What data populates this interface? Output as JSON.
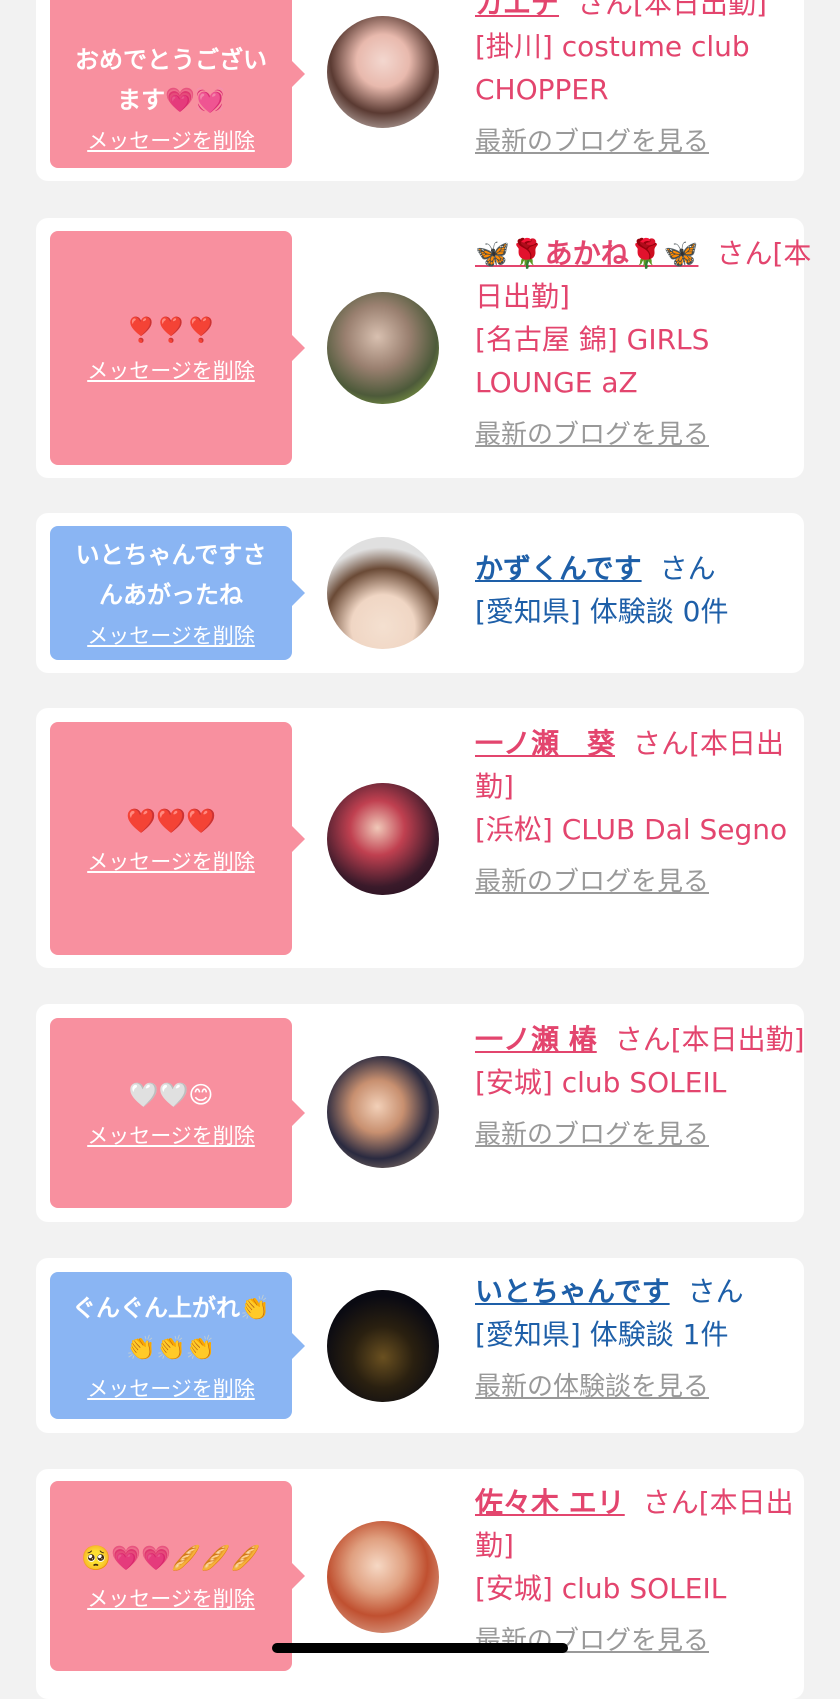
{
  "colors": {
    "pink_bubble": "#f8909f",
    "blue_bubble": "#8ab5f3",
    "pink_text": "#e3456e",
    "blue_text": "#1e5fa8"
  },
  "delete_label": "メッセージを削除",
  "honorific": "さん",
  "cards": [
    {
      "message": "おめでとうござい\nます💗💓",
      "name": "カエデ",
      "name_suffix": "さん[本日出勤]",
      "shop": "[掛川] costume club CHOPPER",
      "link": "最新のブログを見る"
    },
    {
      "message": "❣️❣️❣️",
      "name": "🦋🌹あかね🌹🦋",
      "name_suffix": "さん[本日出勤]",
      "shop": "[名古屋 錦] GIRLS LOUNGE aZ",
      "link": "最新のブログを見る"
    },
    {
      "message": "いとちゃんですさ\nんあがったね",
      "name": "かずくんです",
      "name_suffix": "さん",
      "shop": "[愛知県] 体験談 0件",
      "link": ""
    },
    {
      "message": "❤️❤️❤️",
      "name": "一ノ瀬　葵",
      "name_suffix": "さん[本日出勤]",
      "shop": "[浜松] CLUB Dal Segno",
      "link": "最新のブログを見る"
    },
    {
      "message": "🤍🤍😊",
      "name": "一ノ瀬 椿",
      "name_suffix": "さん[本日出勤]",
      "shop": "[安城] club SOLEIL",
      "link": "最新のブログを見る"
    },
    {
      "message": "ぐんぐん上がれ👏\n👏👏👏",
      "name": "いとちゃんです",
      "name_suffix": "さん",
      "shop": "[愛知県] 体験談 1件",
      "link": "最新の体験談を見る"
    },
    {
      "message": "🥺💗💗🥖🥖🥖",
      "name": "佐々木 エリ",
      "name_suffix": "さん[本日出勤]",
      "shop": "[安城] club SOLEIL",
      "link": "最新のブログを見る"
    }
  ]
}
